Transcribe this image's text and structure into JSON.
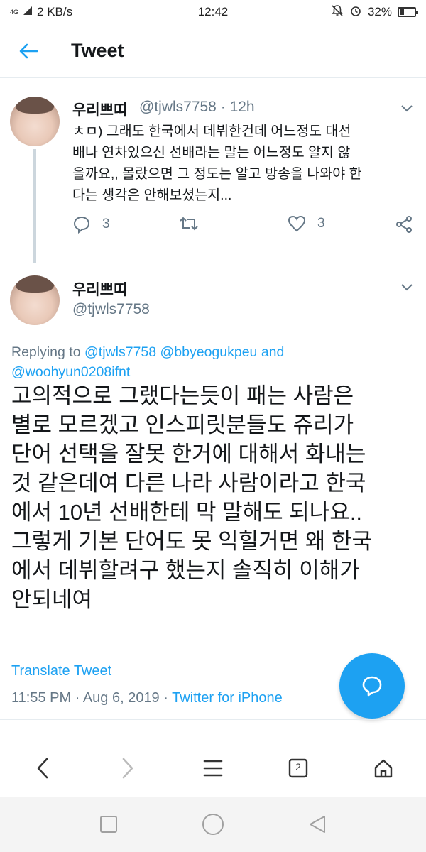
{
  "status_bar": {
    "network": "4G",
    "speed": "2 KB/s",
    "time": "12:42",
    "battery_text": "32%",
    "battery_level": 0.32
  },
  "header": {
    "title": "Tweet"
  },
  "parent_tweet": {
    "display_name": "우리쁘띠",
    "handle": "@tjwls7758",
    "dot": "·",
    "time_ago": "12h",
    "lines": [
      "ㅊㅁ) 그래도 한국에서 데뷔한건데 어느정도 대선",
      "배나 연차있으신 선배라는 말는 어느정도 알지 않",
      "을까요,, 몰랐으면 그 정도는 알고 방송을 나와야 한",
      "다는 생각은 안해보셨는지..."
    ],
    "reply_count": "3",
    "like_count": "3"
  },
  "main_tweet": {
    "display_name": "우리쁘띠",
    "handle": "@tjwls7758",
    "replying_prefix": "Replying to",
    "replying_user1": "@tjwls7758",
    "replying_user2": "@bbyeogukpeu",
    "replying_and": "and",
    "replying_user3": "@woohyun0208ifnt",
    "lines": [
      "고의적으로 그랬다는듯이 패는 사람은",
      "별로 모르겠고 인스피릿분들도 쥬리가",
      "단어 선택을 잘못 한거에 대해서 화내는",
      "것 같은데여 다른 나라 사람이라고 한국",
      "에서 10년 선배한테 막 말해도 되나요..",
      "그렇게 기본 단어도 못 익힐거면 왜 한국",
      "에서 데뷔할려구 했는지 솔직히 이해가",
      "안되네여"
    ],
    "translate_label": "Translate Tweet",
    "timestamp": "11:55 PM",
    "sep1": "·",
    "date": "Aug 6, 2019",
    "sep2": "·",
    "source": "Twitter for iPhone"
  },
  "browser_nav": {
    "tab_count": "2"
  },
  "colors": {
    "accent": "#1da1f2",
    "muted": "#657786",
    "text": "#14171a"
  }
}
